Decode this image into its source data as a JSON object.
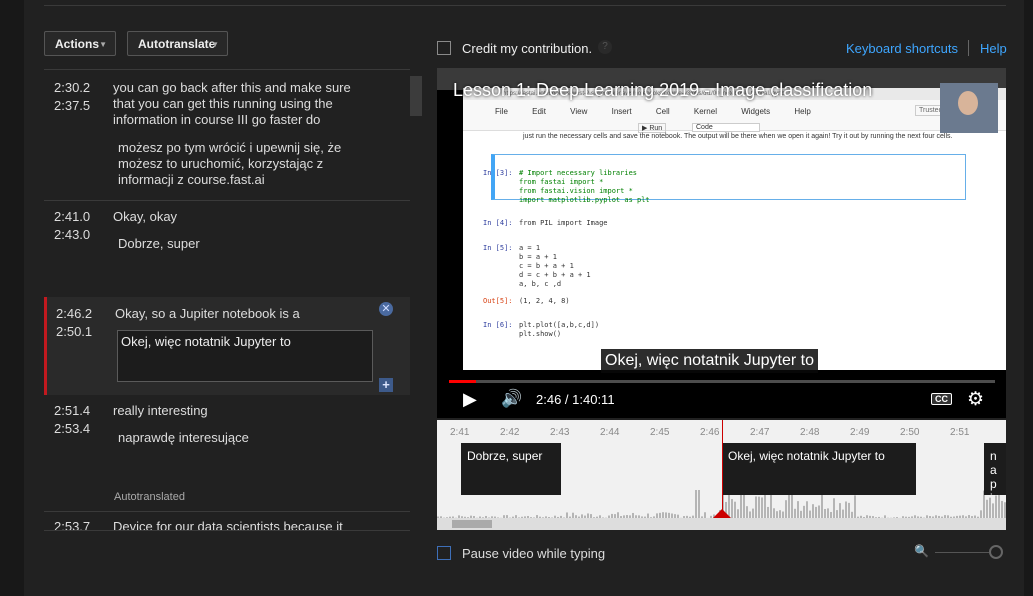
{
  "toolbar": {
    "actions_label": "Actions",
    "autotranslate_label": "Autotranslate"
  },
  "caption_rows": [
    {
      "start": "2:30.2",
      "end": "2:37.5",
      "source": "you can go back after this and make sure that you can get this running using the information in course III go faster do",
      "translation": "możesz po tym wrócić i upewnij się, że możesz to uruchomić, korzystając z informacji z course.fast.ai"
    },
    {
      "start": "2:41.0",
      "end": "2:43.0",
      "source": "Okay, okay",
      "translation": "Dobrze, super"
    },
    {
      "start": "2:46.2",
      "end": "2:50.1",
      "source": "Okay, so a Jupiter notebook is a",
      "translation": "Okej, więc notatnik Jupyter to"
    },
    {
      "start": "2:51.4",
      "end": "2:53.4",
      "source": "really interesting",
      "translation": "naprawdę interesujące"
    },
    {
      "start": "2:53.7",
      "end": "",
      "source": "Device for our data scientists because it",
      "translation": ""
    }
  ],
  "autotranslated_label": "Autotranslated",
  "credit": {
    "label": "Credit my contribution."
  },
  "links": {
    "keyboard_shortcuts": "Keyboard shortcuts",
    "help": "Help"
  },
  "video": {
    "title": "Lesson 1: Deep Learning 2019 - Image classification",
    "url": "https://fastai.notebook.us-west-2.sagemaker.aws/notebooks/course-v3/nbs/dl1/00_notebook_tutorial.ipynb",
    "menu": [
      "File",
      "Edit",
      "View",
      "Insert",
      "Cell",
      "Kernel",
      "Widgets",
      "Help"
    ],
    "trusted": "Trusted",
    "code_select": "Code",
    "run_label": "Run",
    "intro_text": "just run the necessary cells and save the notebook. The output will be there when we open it again! Try it out by running the next four cells.",
    "cells": [
      {
        "prompt": "In [3]:",
        "code": "# Import necessary libraries\nfrom fastai import *\nfrom fastai.vision import *\nimport matplotlib.pyplot as plt"
      },
      {
        "prompt": "In [4]:",
        "code": "from PIL import Image"
      },
      {
        "prompt": "In [5]:",
        "code": "a = 1\nb = a + 1\nc = b + a + 1\nd = c + b + a + 1\na, b, c ,d"
      },
      {
        "prompt": "Out[5]:",
        "code": "(1, 2, 4, 8)"
      },
      {
        "prompt": "In [6]:",
        "code": "plt.plot([a,b,c,d])\nplt.show()"
      }
    ],
    "caption": "Okej, więc notatnik Jupyter to",
    "time_display": "2:46 / 1:40:11",
    "cc_label": "CC",
    "progress": 0.05
  },
  "timeline": {
    "ticks": [
      "2:41",
      "2:42",
      "2:43",
      "2:44",
      "2:45",
      "2:46",
      "2:47",
      "2:48",
      "2:49",
      "2:50",
      "2:51"
    ],
    "cues": [
      "Dobrze, super",
      "Okej, więc notatnik Jupyter to",
      "nap inte"
    ]
  },
  "pause_label": "Pause video while typing"
}
